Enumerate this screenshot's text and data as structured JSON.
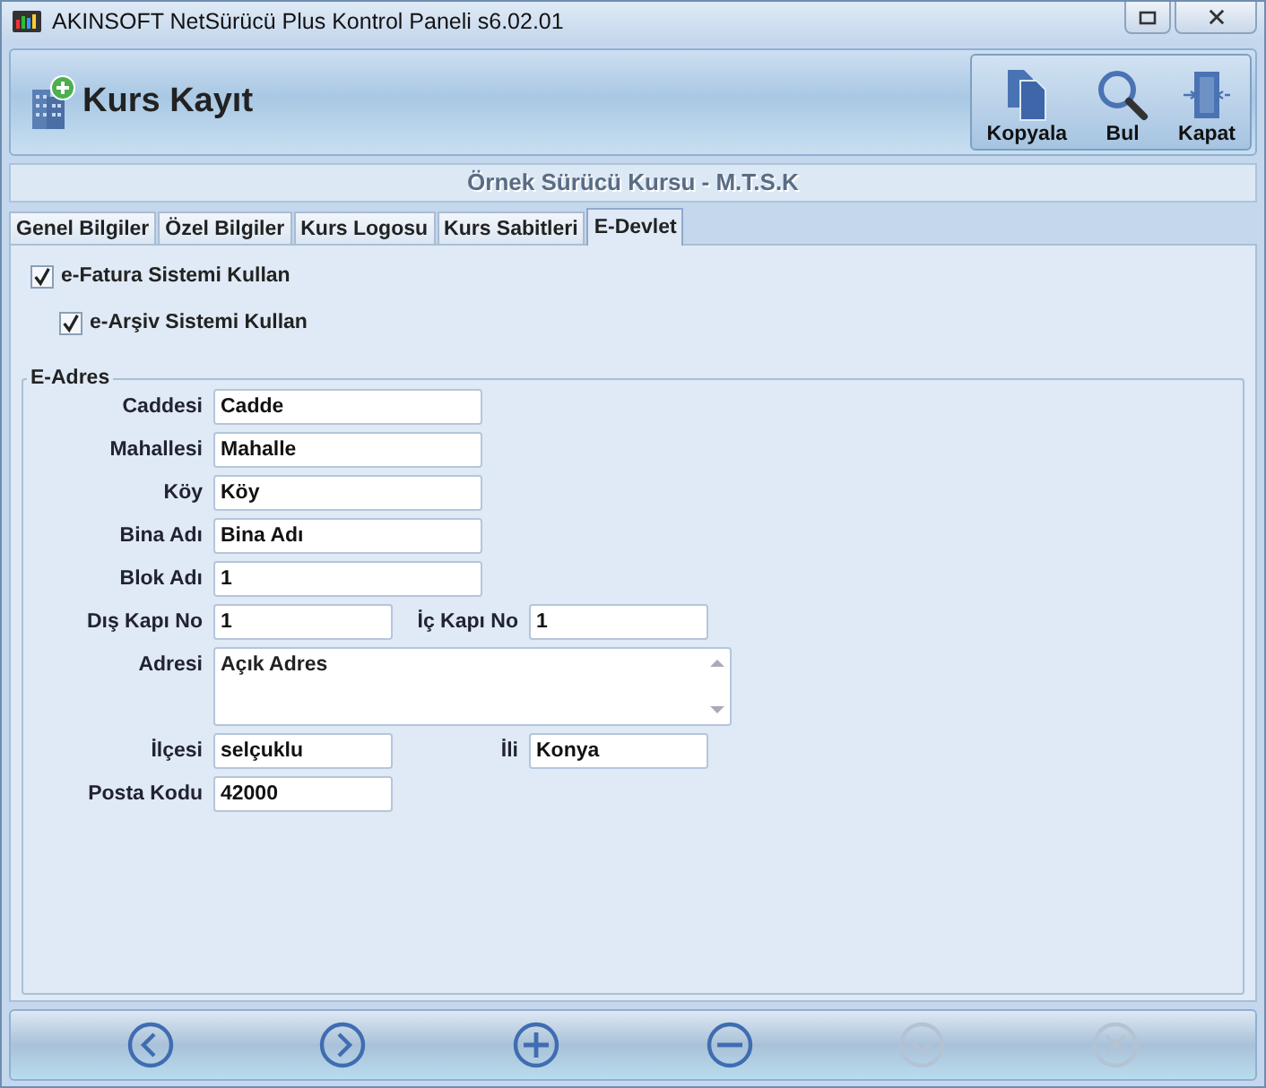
{
  "window": {
    "title": "AKINSOFT NetSürücü Plus Kontrol Paneli s6.02.01"
  },
  "header": {
    "title": "Kurs Kayıt",
    "buttons": [
      {
        "label": "Kopyala",
        "kind": "copy"
      },
      {
        "label": "Bul",
        "kind": "search"
      },
      {
        "label": "Kapat",
        "kind": "close"
      }
    ]
  },
  "company": "Örnek Sürücü Kursu - M.T.S.K",
  "tabs": [
    {
      "label": "Genel Bilgiler",
      "selected": false
    },
    {
      "label": "Özel Bilgiler",
      "selected": false
    },
    {
      "label": "Kurs Logosu",
      "selected": false
    },
    {
      "label": "Kurs Sabitleri",
      "selected": false
    },
    {
      "label": "E-Devlet",
      "selected": true
    }
  ],
  "checkboxes": [
    {
      "label": "e-Fatura Sistemi Kullan",
      "checked": true,
      "indented": false
    },
    {
      "label": "e-Arşiv Sistemi Kullan",
      "checked": true,
      "indented": true
    }
  ],
  "group": {
    "title": "E-Adres",
    "rows": [
      [
        {
          "label": "Caddesi",
          "value": "Cadde",
          "kind": "wide"
        }
      ],
      [
        {
          "label": "Mahallesi",
          "value": "Mahalle",
          "kind": "wide"
        }
      ],
      [
        {
          "label": "Köy",
          "value": "Köy",
          "kind": "wide"
        }
      ],
      [
        {
          "label": "Bina Adı",
          "value": "Bina Adı",
          "kind": "wide"
        }
      ],
      [
        {
          "label": "Blok Adı",
          "value": "1",
          "kind": "wide"
        }
      ],
      [
        {
          "label": "Dış Kapı No",
          "value": "1",
          "kind": "short"
        },
        {
          "label": "İç Kapı No",
          "value": "1",
          "kind": "short"
        }
      ],
      [
        {
          "label": "Adresi",
          "value": "Açık Adres",
          "kind": "memo"
        }
      ],
      [
        {
          "label": "İlçesi",
          "value": "selçuklu",
          "kind": "short"
        },
        {
          "label": "İli",
          "value": "Konya",
          "kind": "short"
        }
      ],
      [
        {
          "label": "Posta Kodu",
          "value": "42000",
          "kind": "short"
        }
      ]
    ]
  },
  "nav": [
    {
      "kind": "previous",
      "disabled": false
    },
    {
      "kind": "next",
      "disabled": false
    },
    {
      "kind": "add",
      "disabled": false
    },
    {
      "kind": "remove",
      "disabled": false
    },
    {
      "kind": "confirm",
      "disabled": true
    },
    {
      "kind": "cancel",
      "disabled": true
    }
  ]
}
